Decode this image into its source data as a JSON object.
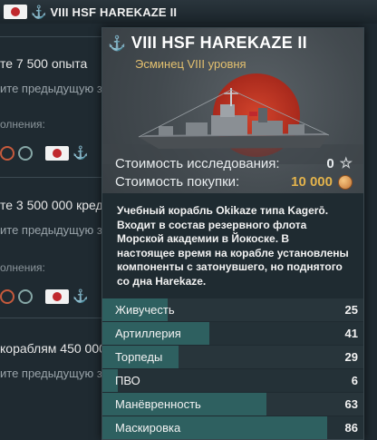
{
  "header": {
    "flag": "japan-flag",
    "rank_icon": "anchor-icon",
    "title": "VIII HSF HAREKAZE II"
  },
  "background": {
    "line1": "те 7 500 опыта",
    "line2": "ите предыдущую за",
    "line3": "олнения:",
    "line4": "те 3 500 000 кред",
    "line5": "ите предыдущую за",
    "line6": "олнения:",
    "line7": "кораблям 450 000",
    "line8": "ите предыдущую за"
  },
  "tooltip": {
    "title": "VIII HSF HAREKAZE II",
    "subtitle": "Эсминец VIII уровня",
    "research_label": "Стоимость исследования:",
    "research_value": "0",
    "buy_label": "Стоимость покупки:",
    "buy_value": "10 000",
    "description": "Учебный корабль Okikaze типа Kagerō. Входит в состав резервного флота Морской академии в Йокоске. В настоящее время на корабле установлены компоненты с затонувшего, но поднятого со дна Harekaze.",
    "stats": [
      {
        "label": "Живучесть",
        "value": 25
      },
      {
        "label": "Артиллерия",
        "value": 41
      },
      {
        "label": "Торпеды",
        "value": 29
      },
      {
        "label": "ПВО",
        "value": 6
      },
      {
        "label": "Манёвренность",
        "value": 63
      },
      {
        "label": "Маскировка",
        "value": 86
      }
    ]
  },
  "colors": {
    "gold": "#e3b34c",
    "stat_fill": "#2e6060",
    "japan_red": "#c0282d"
  }
}
